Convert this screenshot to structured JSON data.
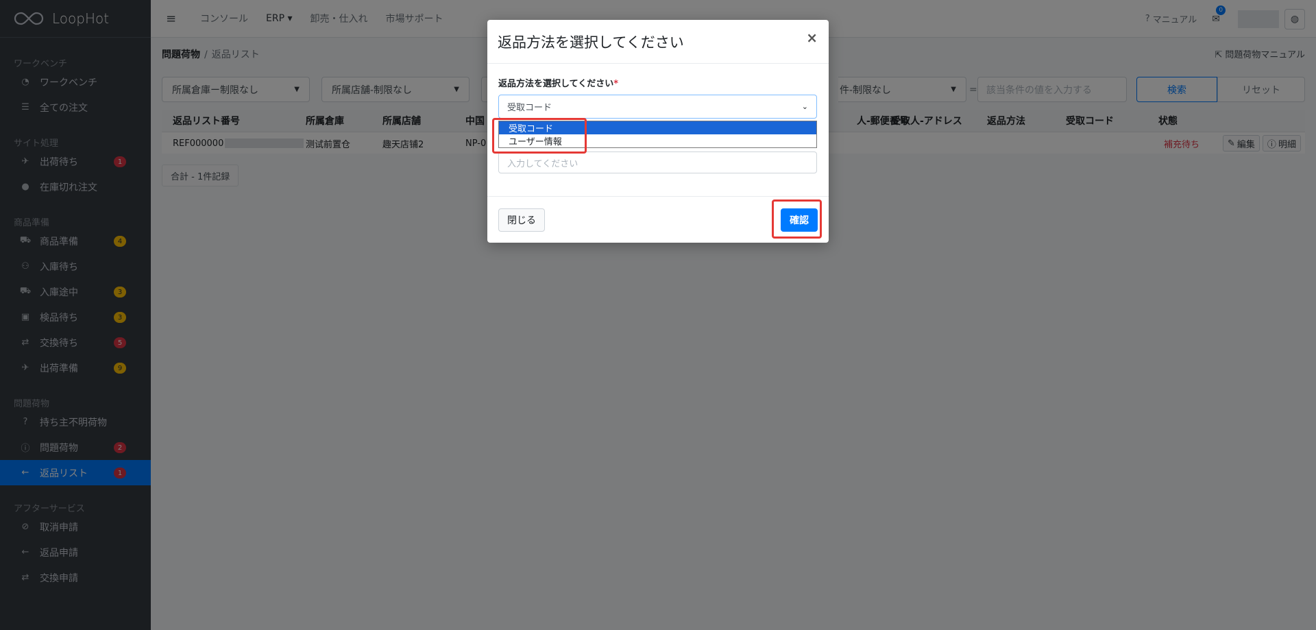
{
  "app": {
    "brand": "LoopHot"
  },
  "topbar": {
    "nav": [
      "コンソール",
      "ERP ▾",
      "卸売・仕入れ",
      "市場サポート"
    ],
    "manual": "マニュアル",
    "mail_count": "0"
  },
  "sidebar": {
    "sections": [
      {
        "header": "ワークベンチ",
        "items": [
          {
            "label": "ワークベンチ",
            "icon": "dashboard-icon"
          },
          {
            "label": "全ての注文",
            "icon": "list-icon"
          }
        ]
      },
      {
        "header": "サイト処理",
        "items": [
          {
            "label": "出荷待ち",
            "icon": "plane-icon",
            "badge": "1",
            "badge_color": "red"
          },
          {
            "label": "在庫切れ注文",
            "icon": "circle-icon"
          }
        ]
      },
      {
        "header": "商品準備",
        "items": [
          {
            "label": "商品準備",
            "icon": "cart-icon",
            "badge": "4",
            "badge_color": "yellow"
          },
          {
            "label": "入庫待ち",
            "icon": "people-icon"
          },
          {
            "label": "入庫途中",
            "icon": "truck-icon",
            "badge": "3",
            "badge_color": "yellow"
          },
          {
            "label": "検品待ち",
            "icon": "box-icon",
            "badge": "3",
            "badge_color": "yellow"
          },
          {
            "label": "交換待ち",
            "icon": "exchange-icon",
            "badge": "5",
            "badge_color": "red"
          },
          {
            "label": "出荷準備",
            "icon": "plane-icon",
            "badge": "9",
            "badge_color": "yellow"
          }
        ]
      },
      {
        "header": "問題荷物",
        "items": [
          {
            "label": "持ち主不明荷物",
            "icon": "question-icon"
          },
          {
            "label": "問題荷物",
            "icon": "info-icon",
            "badge": "2",
            "badge_color": "red"
          },
          {
            "label": "返品リスト",
            "icon": "arrow-left-icon",
            "badge": "1",
            "badge_color": "red",
            "active": true
          }
        ]
      },
      {
        "header": "アフターサービス",
        "items": [
          {
            "label": "取消申請",
            "icon": "ban-icon"
          },
          {
            "label": "返品申請",
            "icon": "arrow-left-icon"
          },
          {
            "label": "交換申請",
            "icon": "exchange-icon"
          }
        ]
      }
    ]
  },
  "breadcrumb": {
    "parent": "問題荷物",
    "current": "返品リスト"
  },
  "page_manual": "問題荷物マニュアル",
  "filters": {
    "warehouse": "所属倉庫ー制限なし",
    "shop": "所属店舗-制限なし",
    "condition": "件-制限なし",
    "value_placeholder": "該当条件の値を入力する",
    "eq": "=",
    "search": "検索",
    "reset": "リセット"
  },
  "table": {
    "headers": [
      "返品リスト番号",
      "所属倉庫",
      "所属店舗",
      "中国",
      "人-郵便番号",
      "受取人-アドレス",
      "返品方法",
      "受取コード",
      "状態"
    ],
    "rows": [
      {
        "id": "REF000000",
        "warehouse": "测试前置仓",
        "shop": "趣天店铺2",
        "cn": "NP-0",
        "status": "補充待ち",
        "edit": "編集",
        "detail": "明細"
      }
    ]
  },
  "total": "合計 - 1件記録",
  "modal": {
    "title": "返品方法を選択してください",
    "close": "×",
    "label": "返品方法を選択してください",
    "required": "*",
    "selected": "受取コード",
    "options": [
      "受取コード",
      "ユーザー情報"
    ],
    "input_placeholder": "入力してください",
    "close_button": "閉じる",
    "confirm_button": "確認"
  },
  "colors": {
    "primary": "#007bff",
    "danger": "#dc3545",
    "warning": "#ffc107",
    "sidebar": "#343a40",
    "highlight": "#e53935"
  }
}
